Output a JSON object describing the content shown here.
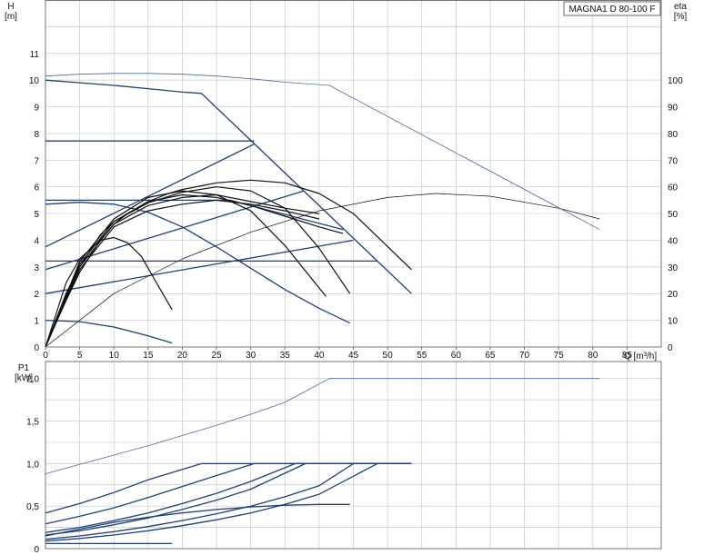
{
  "chart_data": [
    {
      "type": "line",
      "title": "MAGNA1 D 80-100 F",
      "xlabel": "Q [m³/h]",
      "ylabel_top": "H",
      "ylabel_unit": "[m]",
      "y2label_top": "eta",
      "y2label_unit": "[%]",
      "xlim": [
        0,
        90
      ],
      "ylim": [
        0,
        13
      ],
      "y2lim": [
        0,
        130
      ],
      "x_ticks": [
        "0",
        "5",
        "10",
        "15",
        "20",
        "25",
        "30",
        "35",
        "40",
        "45",
        "50",
        "55",
        "60",
        "65",
        "70",
        "75",
        "80",
        "85"
      ],
      "y_ticks": [
        "0",
        "1",
        "2",
        "3",
        "4",
        "5",
        "6",
        "7",
        "8",
        "9",
        "10",
        "11"
      ],
      "y2_ticks": [
        "0",
        "10",
        "20",
        "30",
        "40",
        "50",
        "60",
        "70",
        "80",
        "90",
        "100"
      ],
      "grid": true,
      "colors": {
        "head": "#1f3f7a",
        "eta": "#111111",
        "single_head": "#4a6a9a"
      },
      "series": [
        {
          "kind": "head",
          "x": [
            0,
            5,
            10,
            15,
            20,
            22.8,
            53.5
          ],
          "y": [
            10.0,
            9.9,
            9.8,
            9.68,
            9.55,
            9.5,
            2.0
          ]
        },
        {
          "kind": "head",
          "x": [
            0,
            30.5
          ],
          "y": [
            7.72,
            7.72
          ]
        },
        {
          "kind": "head",
          "x": [
            0,
            30.5
          ],
          "y": [
            3.75,
            7.6
          ]
        },
        {
          "kind": "head",
          "x": [
            0,
            37.8
          ],
          "y": [
            2.9,
            5.85
          ]
        },
        {
          "kind": "head",
          "x": [
            0,
            45
          ],
          "y": [
            2.0,
            4.0
          ]
        },
        {
          "kind": "head",
          "x": [
            0,
            48.5
          ],
          "y": [
            3.22,
            3.22
          ]
        },
        {
          "kind": "head",
          "x": [
            0,
            27,
            43.5
          ],
          "y": [
            5.5,
            5.5,
            4.4
          ]
        },
        {
          "kind": "head",
          "x": [
            0,
            5,
            10,
            15,
            20,
            25,
            30,
            35,
            40,
            44.5
          ],
          "y": [
            5.35,
            5.42,
            5.35,
            5.05,
            4.5,
            3.75,
            2.95,
            2.15,
            1.45,
            0.9
          ]
        },
        {
          "kind": "head",
          "x": [
            0,
            5,
            10,
            15,
            18.5
          ],
          "y": [
            1.0,
            0.95,
            0.75,
            0.42,
            0.15
          ]
        },
        {
          "kind": "eta",
          "x": [
            0,
            2,
            5,
            8,
            10,
            12,
            15,
            18,
            20,
            25,
            30,
            35,
            40,
            45,
            53.5
          ],
          "y": [
            0,
            12,
            28,
            40,
            46,
            50,
            54.5,
            57.5,
            59,
            61.5,
            62.5,
            61.5,
            57.5,
            50,
            29
          ]
        },
        {
          "kind": "eta",
          "x": [
            0,
            3,
            5,
            8,
            10,
            15,
            20,
            25,
            30,
            35,
            40,
            44.5
          ],
          "y": [
            0,
            20,
            30,
            42,
            47,
            54,
            58,
            60,
            58.5,
            52,
            37,
            20
          ]
        },
        {
          "kind": "eta",
          "x": [
            0,
            5,
            10,
            15,
            20,
            25,
            30,
            35,
            37.5,
            41
          ],
          "y": [
            0,
            32,
            48,
            56,
            58.5,
            57,
            51,
            38,
            30,
            19
          ]
        },
        {
          "kind": "eta",
          "x": [
            0,
            3,
            5,
            8,
            10,
            12,
            14,
            16,
            18.5
          ],
          "y": [
            0,
            24,
            33,
            40,
            41,
            39,
            34,
            25,
            14
          ]
        },
        {
          "kind": "eta",
          "x": [
            0,
            5,
            10,
            15,
            20,
            25,
            30,
            35,
            40,
            43.5
          ],
          "y": [
            0,
            31,
            47,
            54.5,
            57,
            56,
            53,
            49,
            45,
            42.5
          ]
        },
        {
          "kind": "eta",
          "x": [
            0,
            5,
            10,
            15,
            20,
            25,
            30,
            35,
            40
          ],
          "y": [
            0,
            30,
            46,
            53,
            56,
            57,
            54.5,
            52,
            50
          ]
        },
        {
          "kind": "eta",
          "x": [
            0,
            5,
            10,
            15,
            20,
            25,
            30,
            35,
            40
          ],
          "y": [
            0,
            29,
            45,
            51,
            53.5,
            55,
            53.5,
            51,
            48
          ]
        },
        {
          "kind": "single_eta",
          "x": [
            0,
            10,
            20,
            30,
            40,
            50,
            57,
            65,
            75,
            81
          ],
          "y": [
            0,
            20,
            33,
            43,
            51,
            56,
            57.5,
            56.5,
            52,
            48
          ]
        },
        {
          "kind": "single_head",
          "x": [
            0,
            5,
            10,
            15,
            20,
            25,
            30,
            35,
            41.5,
            81
          ],
          "y": [
            10.15,
            10.22,
            10.25,
            10.25,
            10.22,
            10.15,
            10.05,
            9.92,
            9.8,
            4.4
          ]
        }
      ]
    },
    {
      "type": "line",
      "ylabel_top": "P1",
      "ylabel_unit": "[kW]",
      "xlim": [
        0,
        90
      ],
      "ylim": [
        0,
        2.2
      ],
      "y_ticks": [
        "0",
        "0,5",
        "1,0",
        "1,5",
        "2,0"
      ],
      "grid": true,
      "series": [
        {
          "kind": "power",
          "x": [
            0,
            5,
            10,
            15,
            22.8,
            53.5
          ],
          "y": [
            0.42,
            0.53,
            0.66,
            0.81,
            1.0,
            1.0
          ]
        },
        {
          "kind": "power",
          "x": [
            0,
            5,
            10,
            15,
            20,
            25,
            30.5,
            53.5
          ],
          "y": [
            0.29,
            0.38,
            0.48,
            0.6,
            0.73,
            0.86,
            1.0,
            1.0
          ]
        },
        {
          "kind": "power",
          "x": [
            0,
            5,
            10,
            15,
            20,
            25,
            30,
            36.5,
            53.5
          ],
          "y": [
            0.19,
            0.25,
            0.33,
            0.42,
            0.53,
            0.65,
            0.79,
            1.0,
            1.0
          ]
        },
        {
          "kind": "power",
          "x": [
            0,
            5,
            10,
            15,
            20,
            25,
            30,
            38,
            53.5
          ],
          "y": [
            0.16,
            0.21,
            0.28,
            0.36,
            0.46,
            0.57,
            0.7,
            1.0,
            1.0
          ]
        },
        {
          "kind": "power",
          "x": [
            0,
            5,
            10,
            15,
            20,
            25,
            30,
            35,
            40,
            45,
            53.5
          ],
          "y": [
            0.11,
            0.15,
            0.2,
            0.26,
            0.33,
            0.41,
            0.5,
            0.61,
            0.74,
            1.0,
            1.0
          ]
        },
        {
          "kind": "power",
          "x": [
            0,
            5,
            10,
            15,
            20,
            25,
            30,
            35,
            40,
            48.5
          ],
          "y": [
            0.09,
            0.12,
            0.16,
            0.21,
            0.27,
            0.34,
            0.42,
            0.52,
            0.64,
            1.0
          ]
        },
        {
          "kind": "power",
          "x": [
            0,
            5,
            10,
            15,
            20,
            25,
            30,
            35,
            40,
            44.5
          ],
          "y": [
            0.15,
            0.23,
            0.31,
            0.37,
            0.42,
            0.46,
            0.49,
            0.51,
            0.52,
            0.52
          ]
        },
        {
          "kind": "power",
          "x": [
            0,
            5,
            10,
            15,
            18.5
          ],
          "y": [
            0.06,
            0.06,
            0.06,
            0.06,
            0.06
          ]
        },
        {
          "kind": "single_power",
          "x": [
            0,
            5,
            10,
            15,
            20,
            25,
            30,
            35,
            41.5,
            81
          ],
          "y": [
            0.88,
            0.99,
            1.1,
            1.21,
            1.33,
            1.45,
            1.58,
            1.72,
            2.0,
            2.0
          ]
        }
      ]
    }
  ]
}
